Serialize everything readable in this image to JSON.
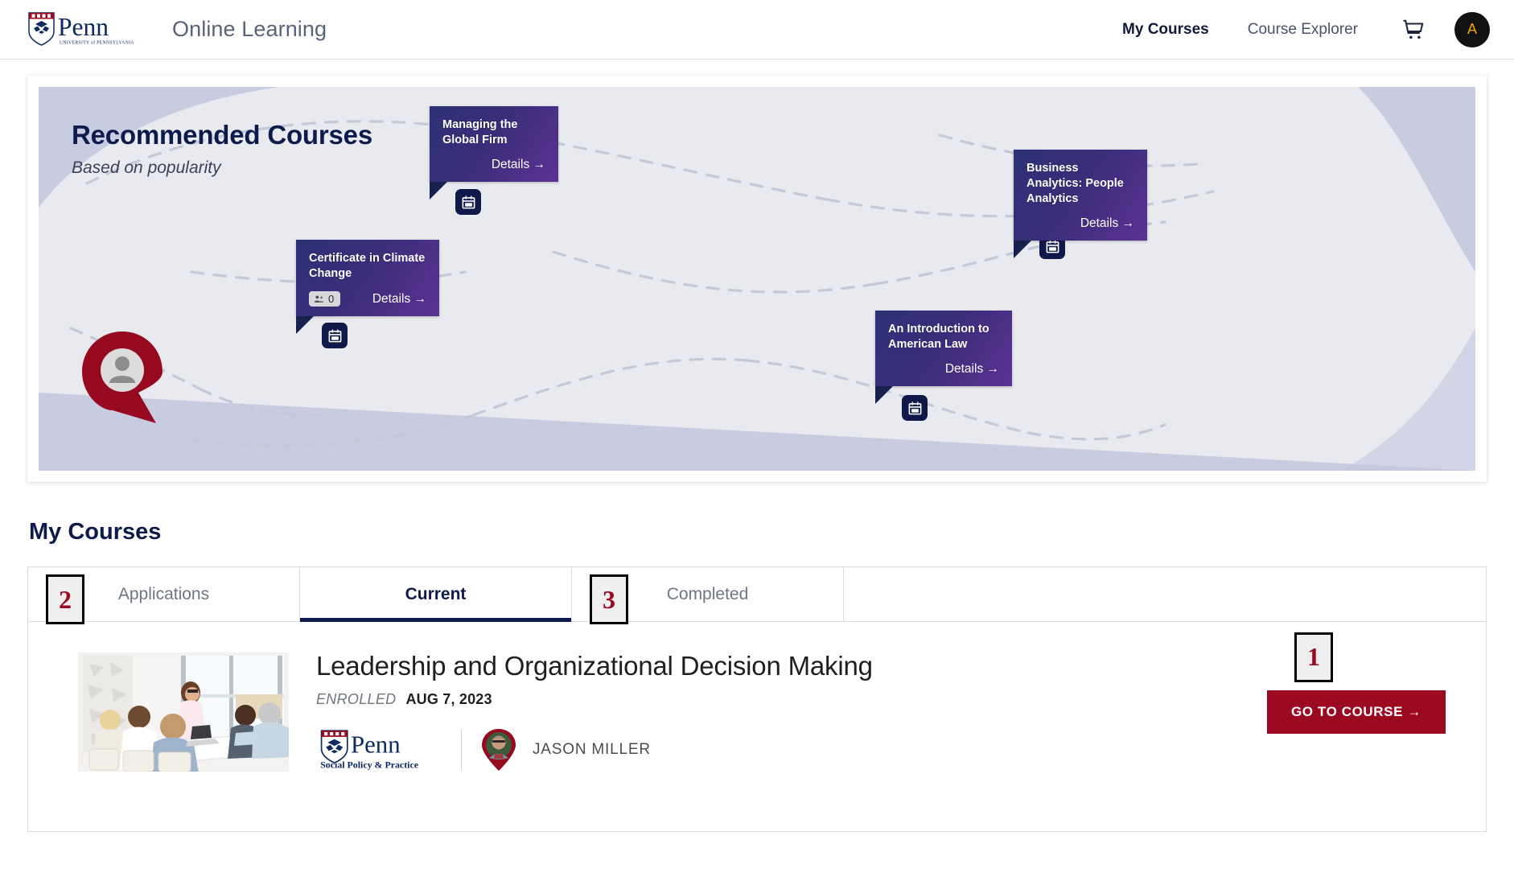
{
  "header": {
    "logo_alt": "University of Pennsylvania",
    "brand_title": "Online Learning",
    "nav": [
      {
        "label": "My Courses",
        "active": true
      },
      {
        "label": "Course Explorer",
        "active": false
      }
    ],
    "cart_icon": "shopping-cart-icon",
    "avatar_initial": "A"
  },
  "banner": {
    "title": "Recommended Courses",
    "subtitle": "Based on popularity",
    "details_label": "Details →",
    "cards": [
      {
        "title": "Managing the Global Firm",
        "details": "Details →",
        "badge": null
      },
      {
        "title": "Certificate in Climate Change",
        "details": "Details →",
        "badge": "0",
        "badge_icon": "people-icon"
      },
      {
        "title": "Business Analytics: People Analytics",
        "details": "Details →",
        "badge": null
      },
      {
        "title": "An Introduction to American Law",
        "details": "Details →",
        "badge": null
      }
    ]
  },
  "my_courses": {
    "section_title": "My Courses",
    "tabs": [
      {
        "label": "Applications",
        "active": false
      },
      {
        "label": "Current",
        "active": true
      },
      {
        "label": "Completed",
        "active": false
      }
    ],
    "course": {
      "name": "Leadership and Organizational Decision Making",
      "status_label": "ENROLLED",
      "status_date": "AUG 7, 2023",
      "school_logo": "Penn Social Policy & Practice",
      "school_line1": "Penn",
      "school_line2": "Social Policy & Practice",
      "instructor": "JASON MILLER",
      "action_label": "GO TO COURSE →"
    }
  },
  "annotations": [
    {
      "id": "1",
      "target": "go-to-course-button"
    },
    {
      "id": "2",
      "target": "tab-applications"
    },
    {
      "id": "3",
      "target": "tab-completed"
    }
  ],
  "colors": {
    "penn_red": "#9c0a21",
    "penn_navy": "#0d1b4c",
    "banner_bg": "#e8eaef",
    "card_gradient_start": "#2c3277",
    "card_gradient_end": "#5b3294"
  }
}
